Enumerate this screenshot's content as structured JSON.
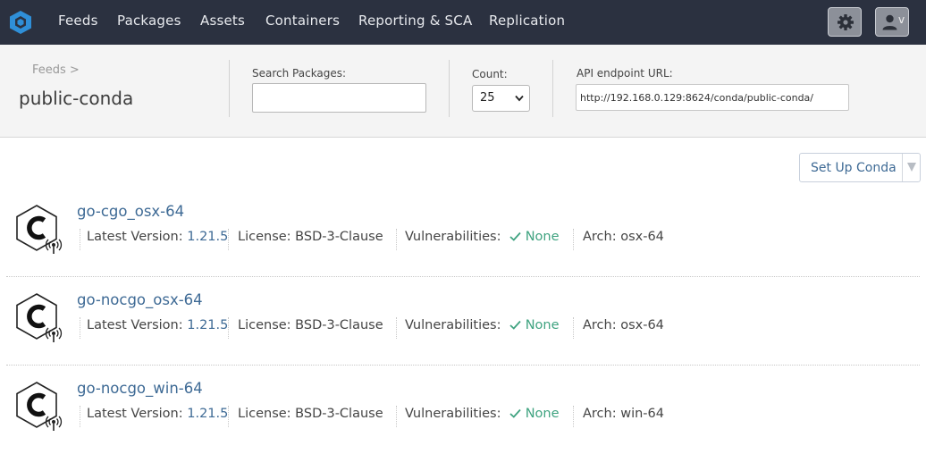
{
  "nav": {
    "items": [
      {
        "label": "Feeds"
      },
      {
        "label": "Packages"
      },
      {
        "label": "Assets"
      },
      {
        "label": "Containers"
      },
      {
        "label": "Reporting & SCA"
      },
      {
        "label": "Replication"
      }
    ],
    "settings_icon": "gear-icon",
    "user_icon": "user-icon",
    "user_caret": "v",
    "colors": {
      "bar": "#2b3140",
      "logo": "#2f8fd8"
    }
  },
  "header": {
    "breadcrumb": "Feeds >",
    "feed_title": "public-conda",
    "search": {
      "label": "Search Packages:",
      "value": ""
    },
    "count": {
      "label": "Count:",
      "value": "25"
    },
    "api": {
      "label": "API endpoint URL:",
      "value": "http://192.168.0.129:8624/conda/public-conda/"
    }
  },
  "setup_button": {
    "label": "Set Up Conda"
  },
  "labels": {
    "latest_version": "Latest Version:",
    "license": "License:",
    "vulnerabilities": "Vulnerabilities:",
    "arch": "Arch:"
  },
  "packages": [
    {
      "name": "go-cgo_osx-64",
      "version": "1.21.5",
      "license": "BSD-3-Clause",
      "vulnerabilities": "None",
      "arch": "osx-64"
    },
    {
      "name": "go-nocgo_osx-64",
      "version": "1.21.5",
      "license": "BSD-3-Clause",
      "vulnerabilities": "None",
      "arch": "osx-64"
    },
    {
      "name": "go-nocgo_win-64",
      "version": "1.21.5",
      "license": "BSD-3-Clause",
      "vulnerabilities": "None",
      "arch": "win-64"
    }
  ],
  "colors": {
    "link": "#3e6a95",
    "ok": "#3fa380"
  }
}
